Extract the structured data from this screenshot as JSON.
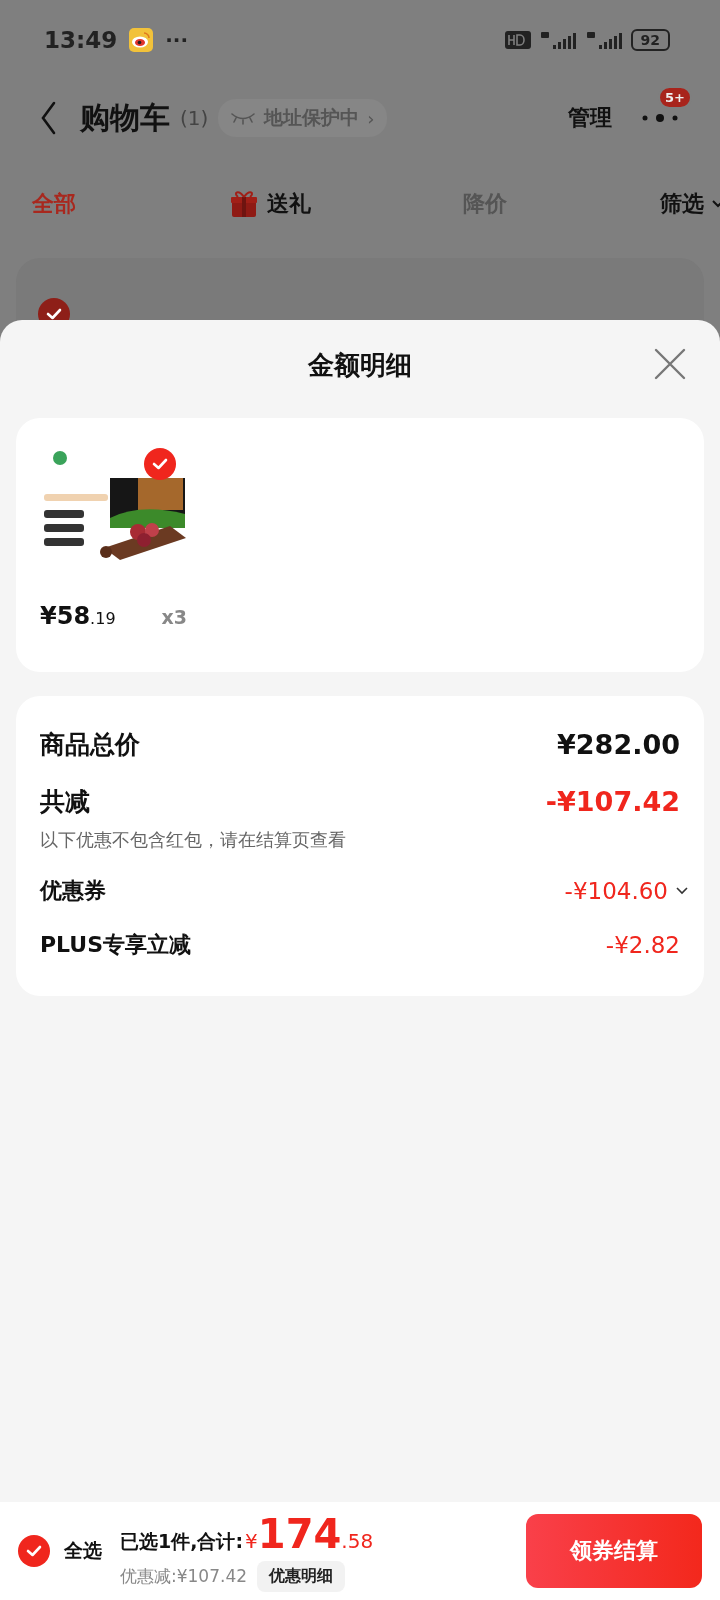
{
  "status_bar": {
    "time": "13:49",
    "more": "···",
    "battery": "92"
  },
  "header": {
    "title": "购物车",
    "count": "(1)",
    "address_pill": "地址保护中",
    "address_arrow": "›",
    "manage": "管理",
    "more_badge": "5+"
  },
  "tabs": [
    {
      "label": "全部",
      "selected": true,
      "kind": "plain"
    },
    {
      "label": "送礼",
      "selected": false,
      "kind": "gift"
    },
    {
      "label": "降价",
      "selected": false,
      "kind": "muted"
    },
    {
      "label": "筛选",
      "selected": false,
      "kind": "filter"
    }
  ],
  "store": {
    "checked": true
  },
  "sheet": {
    "title": "金额明细",
    "items": [
      {
        "kind": "picture",
        "checked": true,
        "price_main": "¥58",
        "price_decimal": ".19",
        "quantity": "x3"
      }
    ],
    "summary": [
      {
        "kind": "total",
        "label": "商品总价",
        "value": "¥282.00"
      },
      {
        "kind": "discount_total",
        "label": "共减",
        "value": "-¥107.42",
        "note": "以下优惠不包含红包，请在结算页查看"
      },
      {
        "kind": "coupon",
        "label": "优惠券",
        "value": "-¥104.60"
      },
      {
        "kind": "discount",
        "label": "PLUS专享立减",
        "value": "-¥2.82"
      }
    ]
  },
  "bottom_bar": {
    "select_all": {
      "label": "全选",
      "checked": true
    },
    "total_label": "已选**1**件,合计:",
    "total_currency": "¥",
    "total_integer": "174",
    "total_decimal": ".58",
    "saving": "优惠减:¥107.42",
    "detail_button": "优惠明细",
    "checkout_button": "领券结算"
  }
}
